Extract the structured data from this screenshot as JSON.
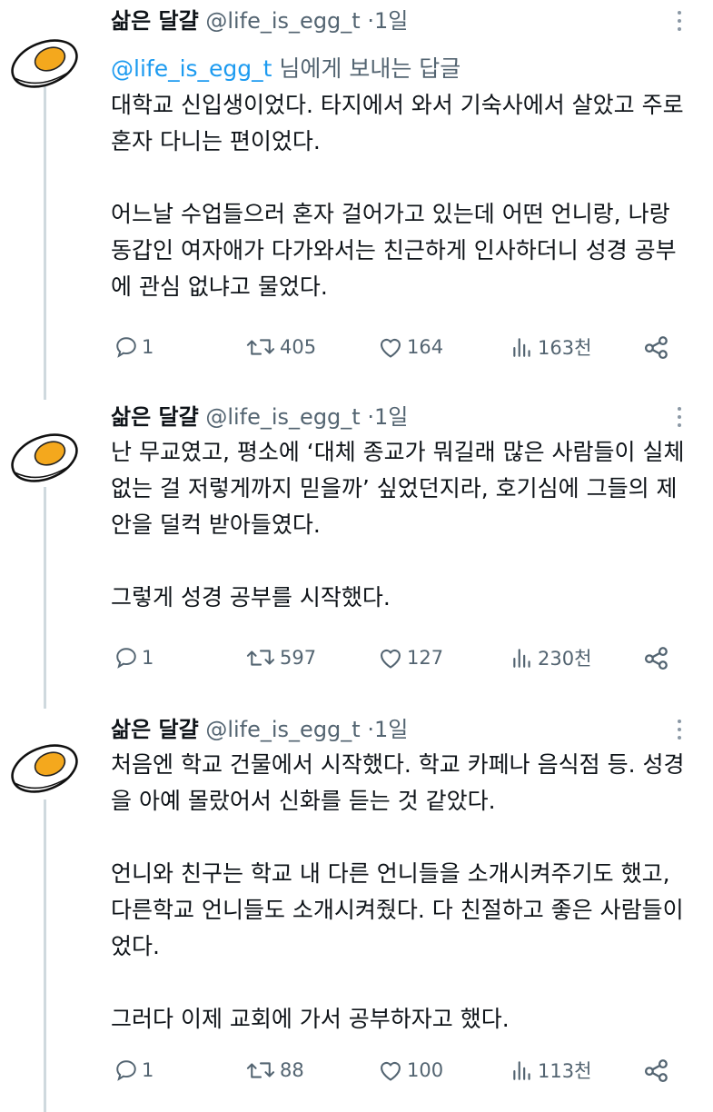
{
  "tweets": [
    {
      "author_name": "삶은 달걀",
      "handle": "@life_is_egg_t",
      "separator": "·",
      "time": "1일",
      "reply_mention": "@life_is_egg_t",
      "reply_suffix": " 님에게 보내는 답글",
      "paragraphs": [
        "대학교 신입생이었다. 타지에서 와서 기숙사에서 살았고 주로 혼자 다니는 편이었다.",
        "어느날 수업들으러 혼자 걸어가고 있는데 어떤 언니랑, 나랑 동갑인 여자애가 다가와서는 친근하게 인사하더니 성경 공부에 관심 없냐고 물었다."
      ],
      "stats": {
        "replies": "1",
        "retweets": "405",
        "likes": "164",
        "views": "163천"
      }
    },
    {
      "author_name": "삶은 달걀",
      "handle": "@life_is_egg_t",
      "separator": "·",
      "time": "1일",
      "paragraphs": [
        "난 무교였고, 평소에 ‘대체 종교가 뭐길래 많은 사람들이 실체 없는 걸 저렇게까지 믿을까’ 싶었던지라, 호기심에 그들의 제안을 덜컥 받아들였다.",
        "그렇게 성경 공부를 시작했다."
      ],
      "stats": {
        "replies": "1",
        "retweets": "597",
        "likes": "127",
        "views": "230천"
      }
    },
    {
      "author_name": "삶은 달걀",
      "handle": "@life_is_egg_t",
      "separator": "·",
      "time": "1일",
      "paragraphs": [
        "처음엔 학교 건물에서 시작했다. 학교 카페나 음식점 등. 성경을 아예 몰랐어서 신화를 듣는 것 같았다.",
        "언니와 친구는 학교 내 다른 언니들을 소개시켜주기도 했고, 다른학교 언니들도 소개시켜줬다. 다 친절하고 좋은 사람들이었다.",
        "그러다 이제 교회에 가서 공부하자고 했다."
      ],
      "stats": {
        "replies": "1",
        "retweets": "88",
        "likes": "100",
        "views": "113천"
      }
    }
  ],
  "colors": {
    "text": "#0f1419",
    "secondary": "#536471",
    "link": "#1d9bf0",
    "thread_line": "#cfd9de",
    "yolk": "#f4a81d"
  },
  "icons": [
    "egg-avatar-icon",
    "more-options-icon",
    "reply-icon",
    "retweet-icon",
    "like-icon",
    "views-icon",
    "share-icon"
  ]
}
